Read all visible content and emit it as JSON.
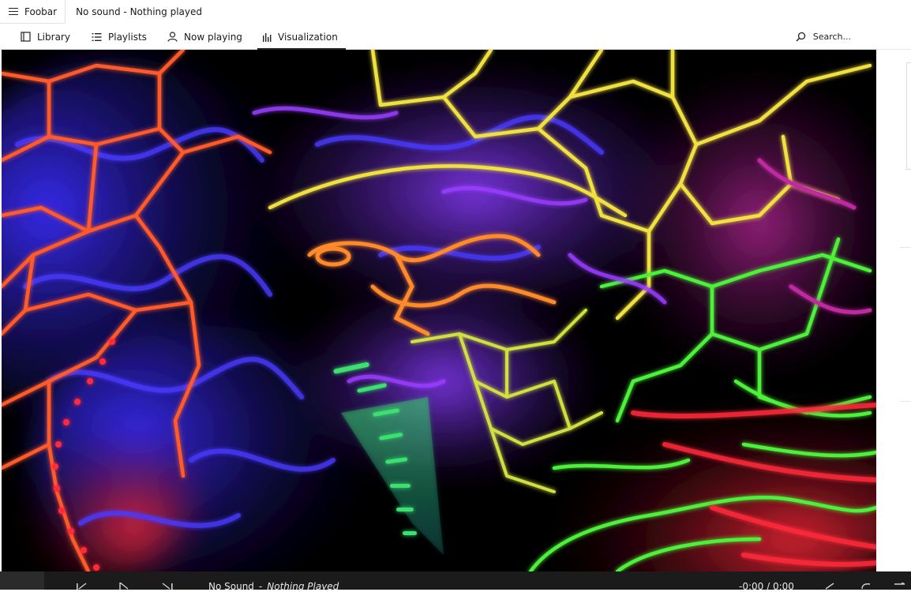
{
  "app": {
    "menu_label": "Foobar",
    "window_title": "No sound - Nothing played"
  },
  "tabs": [
    {
      "label": "Library",
      "icon": "library-icon",
      "active": false
    },
    {
      "label": "Playlists",
      "icon": "playlist-icon",
      "active": false
    },
    {
      "label": "Now playing",
      "icon": "person-icon",
      "active": false
    },
    {
      "label": "Visualization",
      "icon": "bar-chart-icon",
      "active": true
    }
  ],
  "search": {
    "placeholder": "Search..."
  },
  "visualization": {
    "background": "#000000",
    "colors": {
      "orange": "#ff5a2a",
      "yellow": "#f0e040",
      "purple": "#7a2cff",
      "blue": "#3a2cff",
      "green": "#4df03a",
      "red": "#ff2a3a",
      "magenta": "#c02aa0"
    }
  },
  "playback": {
    "artist": "No Sound",
    "separator": "-",
    "track": "Nothing Played",
    "time": "-0:00 / 0:00"
  }
}
